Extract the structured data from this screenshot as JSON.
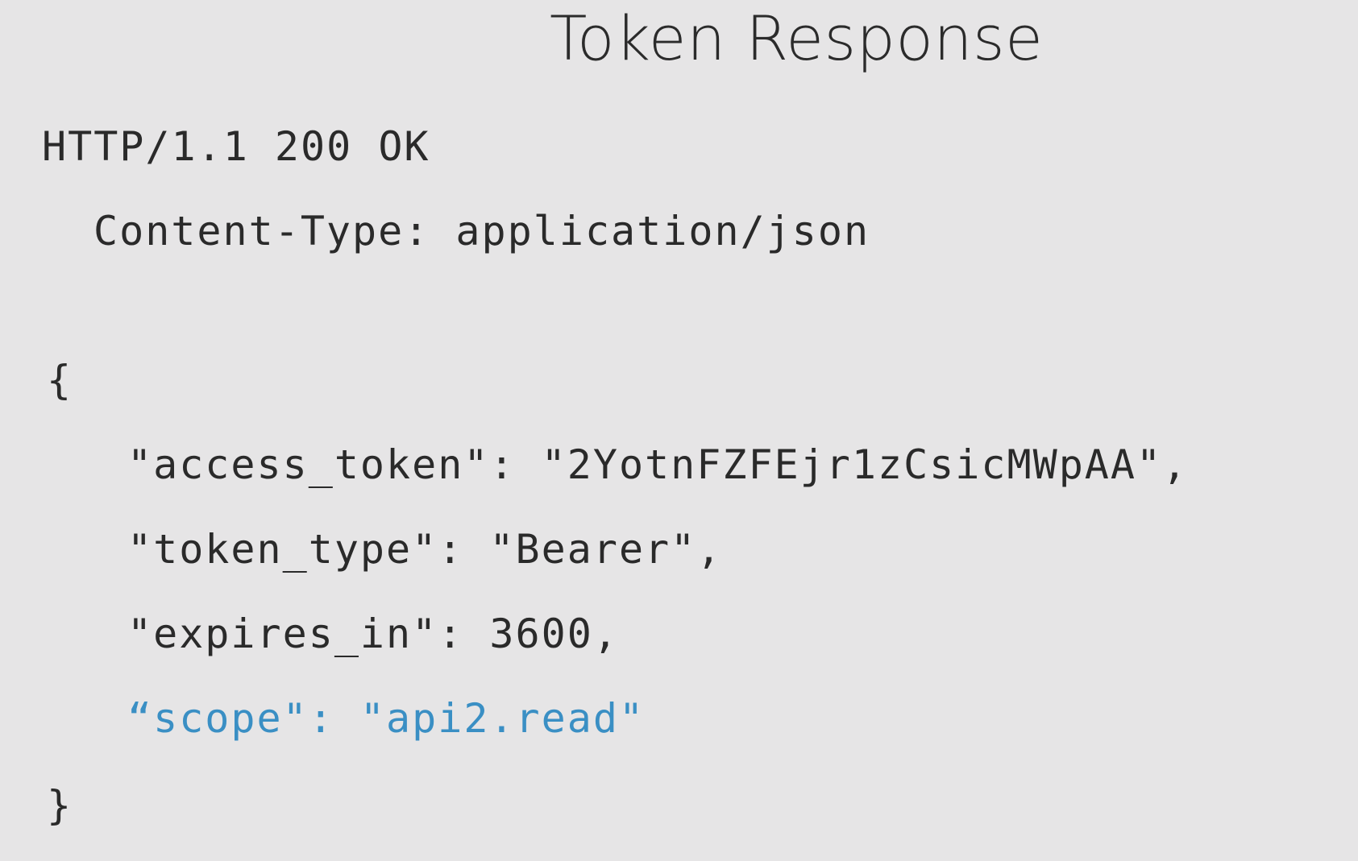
{
  "slide": {
    "title": "Token Response",
    "accent_color": "#3a8fc4",
    "background_color": "#e6e5e6",
    "lines": {
      "status_line": "HTTP/1.1 200 OK",
      "header_line": "Content-Type: application/json",
      "open_brace": "{",
      "access_token_line": "\"access_token\": \"2YotnFZFEjr1zCsicMWpAA\",",
      "token_type_line": "\"token_type\": \"Bearer\",",
      "expires_in_line": "\"expires_in\": 3600,",
      "scope_line": "“scope\": \"api2.read\"",
      "close_brace": "}"
    }
  }
}
